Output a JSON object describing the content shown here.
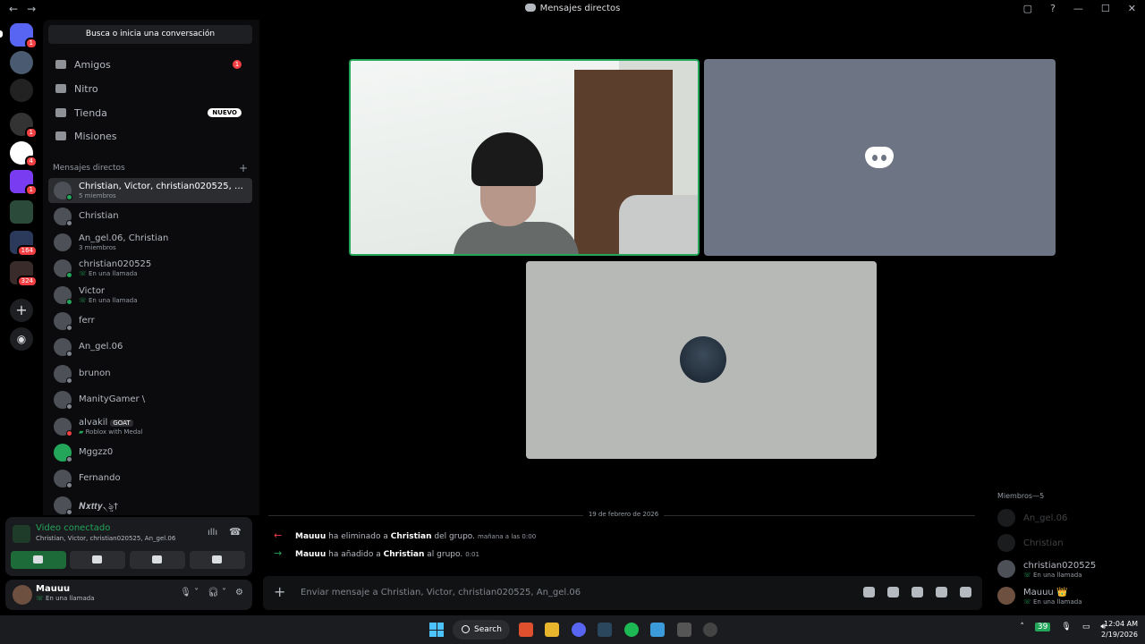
{
  "window": {
    "title": "Mensajes directos"
  },
  "guild_badges": [
    "1",
    "1",
    "4",
    "1",
    "164",
    "324"
  ],
  "search": {
    "label": "Busca o inicia una conversación"
  },
  "nav": {
    "friends": "Amigos",
    "friends_badge": "1",
    "nitro": "Nitro",
    "shop": "Tienda",
    "shop_badge": "NUEVO",
    "quests": "Misiones"
  },
  "dm_section": {
    "title": "Mensajes directos",
    "add": "+"
  },
  "dms": [
    {
      "name": "Christian, Victor, christian020525, An_...",
      "sub": "5 miembros"
    },
    {
      "name": "Christian",
      "sub": ""
    },
    {
      "name": "An_gel.06, Christian",
      "sub": "3 miembros"
    },
    {
      "name": "christian020525",
      "sub": "En una llamada"
    },
    {
      "name": "Victor",
      "sub": "En una llamada"
    },
    {
      "name": "ferr",
      "sub": ""
    },
    {
      "name": "An_gel.06",
      "sub": ""
    },
    {
      "name": "brunon",
      "sub": ""
    },
    {
      "name": "ManityGamer \\",
      "sub": ""
    },
    {
      "name": "alvakil",
      "sub": "Roblox with Medal",
      "tag": "GOAT"
    },
    {
      "name": "Mggzz0",
      "sub": ""
    },
    {
      "name": "Fernando",
      "sub": ""
    },
    {
      "name": "𝑵𝒙𝒕𝒕𝒚৲ৡ†",
      "sub": ""
    }
  ],
  "voice": {
    "status": "Video conectado",
    "channel": "Christian, Victor, christian020525, An_gel.06"
  },
  "user": {
    "name": "Mauuu",
    "status": "En una llamada"
  },
  "chat": {
    "date": "19 de febrero de 2026",
    "messages": [
      {
        "user": "Mauuu",
        "action": "ha eliminado a",
        "target": "Christian",
        "rest": "del grupo.",
        "time": "mañana a las 0:00"
      },
      {
        "user": "Mauuu",
        "action": "ha añadido a",
        "target": "Christian",
        "rest": "al grupo.",
        "time": "0:01"
      }
    ],
    "placeholder": "Enviar mensaje a Christian, Victor, christian020525, An_gel.06"
  },
  "members": {
    "header": "Miembros—5",
    "list": [
      {
        "name": "An_gel.06",
        "sub": ""
      },
      {
        "name": "Christian",
        "sub": ""
      },
      {
        "name": "christian020525",
        "sub": "En una llamada"
      },
      {
        "name": "Mauuu 👑",
        "sub": "En una llamada"
      }
    ]
  },
  "taskbar": {
    "search": "Search",
    "time": "12:04 AM",
    "date": "2/19/2026",
    "badge": "39"
  },
  "colors": {
    "accent_green": "#23a55a",
    "danger": "#f23f43",
    "blurple": "#5865f2"
  }
}
